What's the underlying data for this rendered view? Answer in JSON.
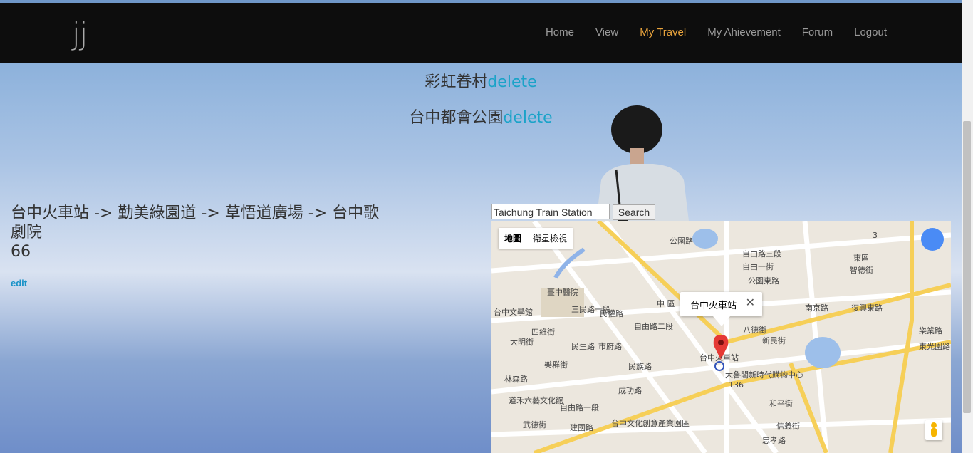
{
  "nav": {
    "brand": "jj",
    "items": [
      "Home",
      "View",
      "My Travel",
      "My Ahievement",
      "Forum",
      "Logout"
    ],
    "active_index": 2,
    "accent": "#e8a33c"
  },
  "favorites": [
    {
      "name": "彩虹眷村",
      "action": "delete"
    },
    {
      "name": "台中都會公園",
      "action": "delete"
    }
  ],
  "route": {
    "path": "台中火車站 -> 勤美綠園道 -> 草悟道廣場 -> 台中歌劇院",
    "count": "66",
    "edit_label": "edit"
  },
  "search": {
    "value": "Taichung Train Station",
    "button_label": "Search"
  },
  "map": {
    "type_map": "地圖",
    "type_satellite": "衛星檢視",
    "info_title": "台中火車站",
    "labels": [
      "公園路",
      "自由路三段",
      "自由一街",
      "公園東路",
      "南京路",
      "復興東路",
      "東區",
      "智德街",
      "中 區",
      "八德街",
      "新民街",
      "台中火車站",
      "大魯閣新時代購物中心",
      "臺中醫院",
      "台中文學館",
      "大明街",
      "四維街",
      "民生路",
      "市府路",
      "自由路二段",
      "三民路一段",
      "民權路",
      "建國路",
      "台中文化創意產業園區",
      "和平街",
      "信義街",
      "樂業路",
      "東光園路",
      "136",
      "3",
      "林森路",
      "道禾六藝文化館",
      "樂群街",
      "忠孝路",
      "自由路一段",
      "武德街",
      "民族路",
      "成功路"
    ]
  }
}
